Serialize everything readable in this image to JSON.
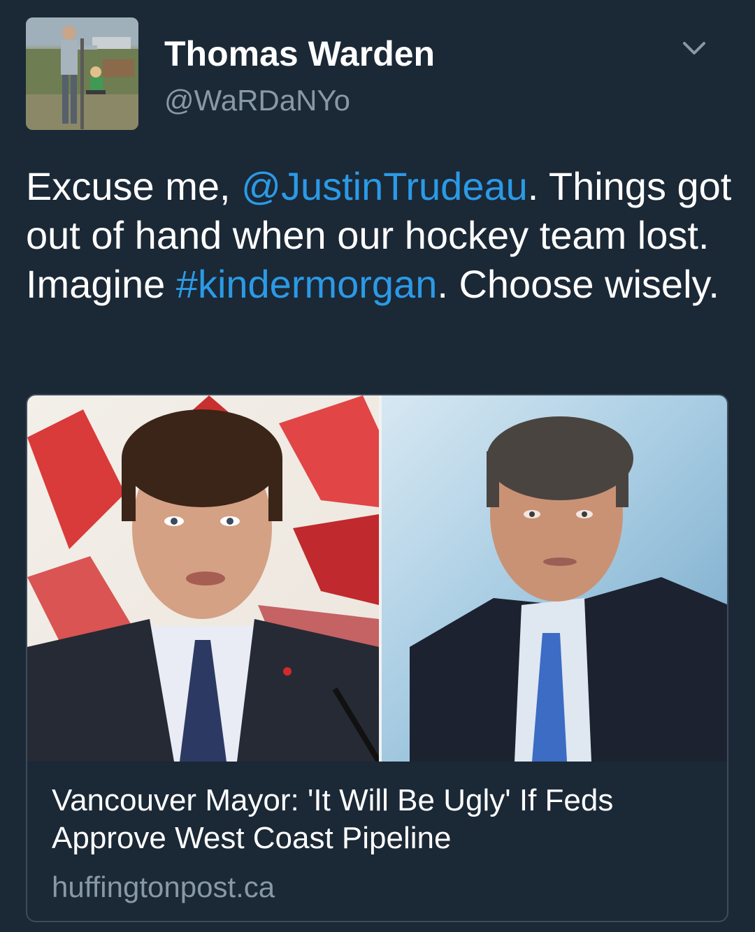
{
  "author": {
    "name": "Thomas Warden",
    "handle": "@WaRDaNYo"
  },
  "menu": {
    "icon": "chevron-down-icon"
  },
  "tweet": {
    "segments": [
      {
        "text": "Excuse me, ",
        "kind": "text"
      },
      {
        "text": "@JustinTrudeau",
        "kind": "mention"
      },
      {
        "text": ". Things got out of hand when our hockey team lost. Imagine ",
        "kind": "text"
      },
      {
        "text": "#kindermorgan",
        "kind": "hashtag"
      },
      {
        "text": ". Choose wisely.",
        "kind": "text"
      }
    ]
  },
  "link_card": {
    "headline": "Vancouver Mayor: 'It Will Be Ugly' If Feds Approve West Coast Pipeline",
    "domain": "huffingtonpost.ca"
  },
  "colors": {
    "background": "#1b2836",
    "link": "#2b9ae6",
    "secondary_text": "#8899a6",
    "card_border": "#3c4c5c"
  }
}
